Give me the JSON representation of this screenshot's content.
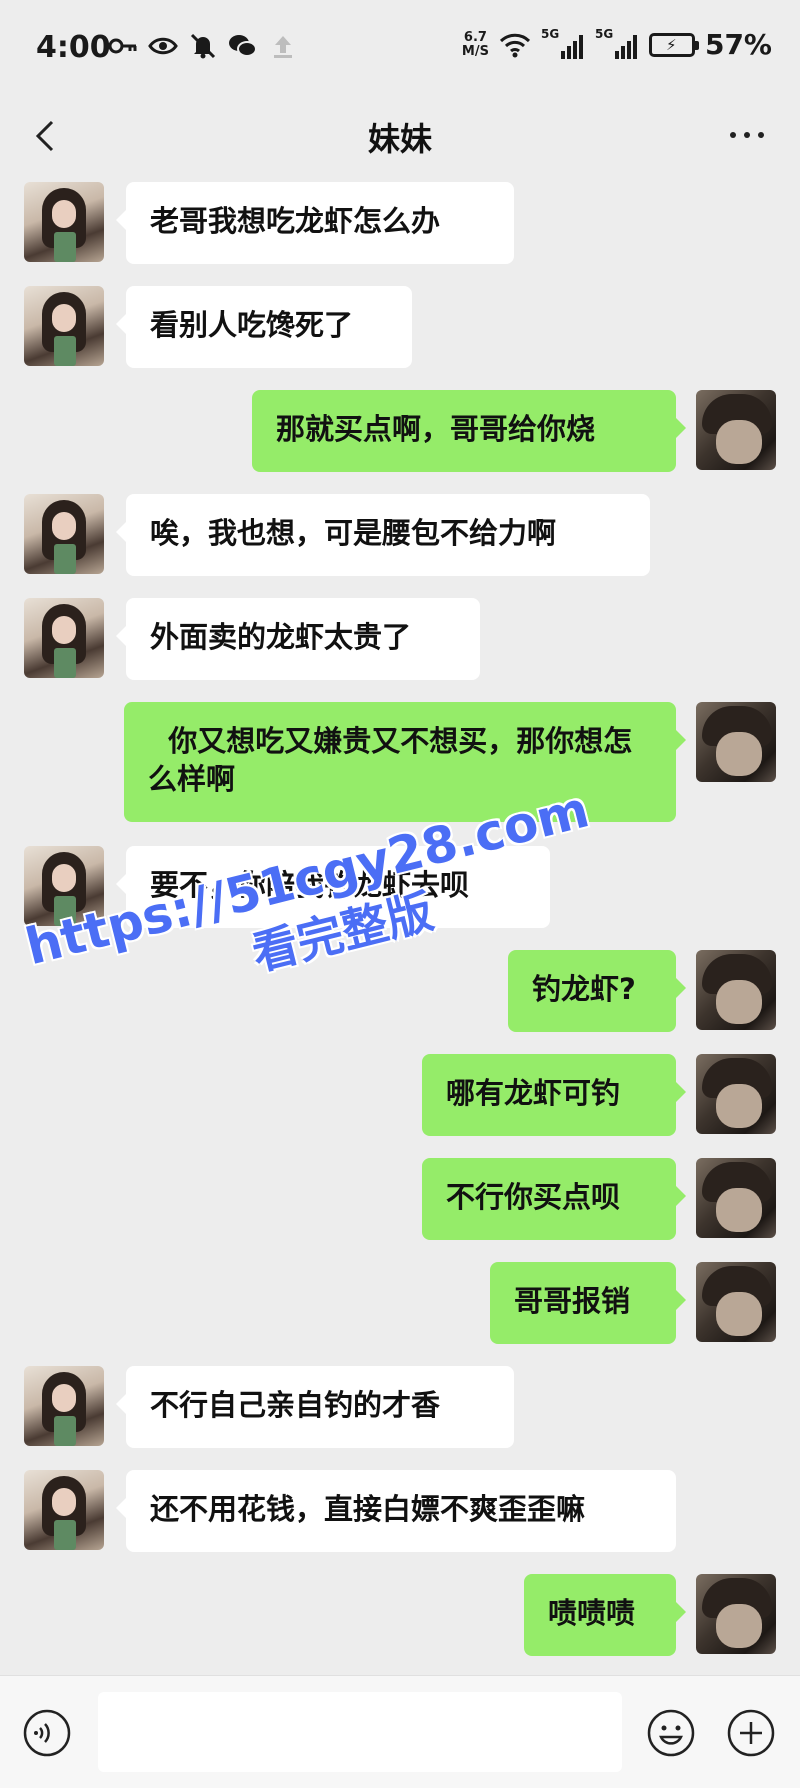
{
  "status_bar": {
    "time": "4:00",
    "net_speed_value": "6.7",
    "net_speed_unit": "M/S",
    "sim1_label": "5G",
    "sim2_label": "5G",
    "battery_percent": "57%"
  },
  "header": {
    "title": "妹妹"
  },
  "messages": [
    {
      "side": "left",
      "text": "老哥我想吃龙虾怎么办"
    },
    {
      "side": "left",
      "text": "看别人吃馋死了"
    },
    {
      "side": "right",
      "text": "那就买点啊，哥哥给你烧"
    },
    {
      "side": "left",
      "text": "唉，我也想，可是腰包不给力啊"
    },
    {
      "side": "left",
      "text": "外面卖的龙虾太贵了"
    },
    {
      "side": "right",
      "text": "  你又想吃又嫌贵又不想买，那你想怎么样啊"
    },
    {
      "side": "left",
      "text": "要不，你陪我钓龙虾去呗"
    },
    {
      "side": "right",
      "text": "钓龙虾?"
    },
    {
      "side": "right",
      "text": "哪有龙虾可钓"
    },
    {
      "side": "right",
      "text": "不行你买点呗"
    },
    {
      "side": "right",
      "text": "哥哥报销"
    },
    {
      "side": "left",
      "text": "不行自己亲自钓的才香"
    },
    {
      "side": "left",
      "text": "还不用花钱，直接白嫖不爽歪歪嘛"
    },
    {
      "side": "right",
      "text": "啧啧啧"
    }
  ],
  "watermark": {
    "url": "https://51cgy28.com",
    "subtitle": "看完整版"
  },
  "input_bar": {
    "text_value": ""
  },
  "colors": {
    "background": "#ededed",
    "bubble_self": "#95ec69",
    "bubble_other": "#ffffff",
    "watermark": "#4b6ef5"
  },
  "icons": {
    "back": "chevron-left-icon",
    "more": "ellipsis-icon",
    "voice": "voice-icon",
    "emoji": "emoji-icon",
    "plus": "plus-icon"
  }
}
